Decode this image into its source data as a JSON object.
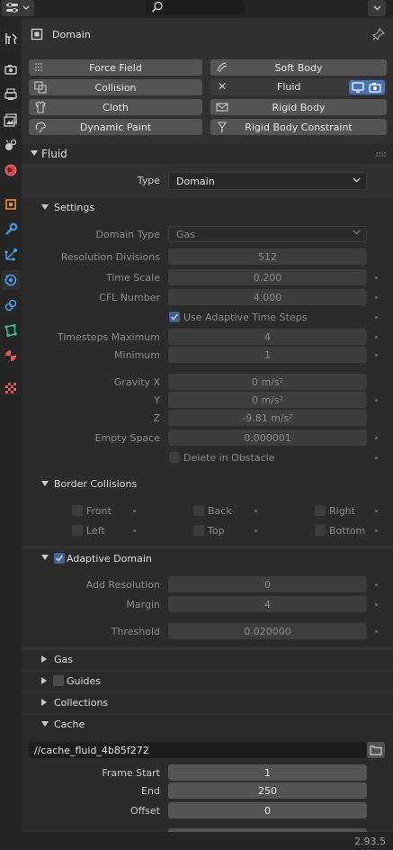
{
  "header": {
    "editor_type_icon": "properties-editor-icon",
    "search_placeholder": ""
  },
  "tabs": [
    {
      "name": "tool-tab-icon",
      "active": false
    },
    {
      "name": "render-tab-icon",
      "active": false
    },
    {
      "name": "output-tab-icon",
      "active": false
    },
    {
      "name": "view-layer-tab-icon",
      "active": false
    },
    {
      "name": "scene-tab-icon",
      "active": false
    },
    {
      "name": "world-tab-icon",
      "active": false
    },
    {
      "name": "object-tab-icon",
      "active": false
    },
    {
      "name": "modifier-tab-icon",
      "active": false
    },
    {
      "name": "particles-tab-icon",
      "active": false
    },
    {
      "name": "physics-tab-icon",
      "active": true
    },
    {
      "name": "constraints-tab-icon",
      "active": false
    },
    {
      "name": "data-tab-icon",
      "active": false
    },
    {
      "name": "material-tab-icon",
      "active": false
    },
    {
      "name": "texture-tab-icon",
      "active": false
    }
  ],
  "object": {
    "name": "Domain"
  },
  "physics_buttons": {
    "force_field": "Force Field",
    "soft_body": "Soft Body",
    "collision": "Collision",
    "fluid": "Fluid",
    "cloth": "Cloth",
    "rigid_body": "Rigid Body",
    "dynamic_paint": "Dynamic Paint",
    "rigid_body_constraint": "Rigid Body Constraint"
  },
  "fluid": {
    "title": "Fluid",
    "type_label": "Type",
    "type_value": "Domain"
  },
  "settings": {
    "title": "Settings",
    "domain_type_label": "Domain Type",
    "domain_type_value": "Gas",
    "resolution_label": "Resolution Divisions",
    "resolution_value": "512",
    "time_scale_label": "Time Scale",
    "time_scale_value": "0.200",
    "cfl_label": "CFL Number",
    "cfl_value": "4.000",
    "adaptive_steps_label": "Use Adaptive Time Steps",
    "timesteps_max_label": "Timesteps Maximum",
    "timesteps_max_value": "4",
    "minimum_label": "Minimum",
    "minimum_value": "1",
    "gravity_x_label": "Gravity X",
    "gravity_x_value": "0 m/s²",
    "gravity_y_label": "Y",
    "gravity_y_value": "0 m/s²",
    "gravity_z_label": "Z",
    "gravity_z_value": "-9.81 m/s²",
    "empty_space_label": "Empty Space",
    "empty_space_value": "0.000001",
    "delete_obstacle_label": "Delete in Obstacle"
  },
  "border_collisions": {
    "title": "Border Collisions",
    "front": "Front",
    "back": "Back",
    "right": "Right",
    "left": "Left",
    "top": "Top",
    "bottom": "Bottom"
  },
  "adaptive_domain": {
    "title": "Adaptive Domain",
    "add_resolution_label": "Add Resolution",
    "add_resolution_value": "0",
    "margin_label": "Margin",
    "margin_value": "4",
    "threshold_label": "Threshold",
    "threshold_value": "0.020000"
  },
  "collapsed": {
    "gas": "Gas",
    "guides": "Guides",
    "collections": "Collections"
  },
  "cache": {
    "title": "Cache",
    "path": "//cache_fluid_4b85f272",
    "frame_start_label": "Frame Start",
    "frame_start_value": "1",
    "end_label": "End",
    "end_value": "250",
    "offset_label": "Offset",
    "offset_value": "0"
  },
  "status": {
    "version": "2.93.5"
  },
  "colors": {
    "accent": "#4772b3",
    "panel": "#303030",
    "field": "#545454"
  }
}
